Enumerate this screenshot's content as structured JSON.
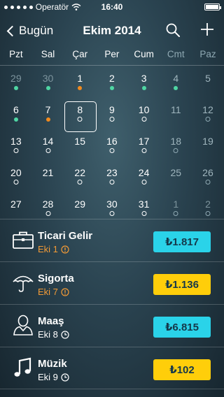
{
  "status_bar": {
    "carrier": "Operatör",
    "time": "16:40"
  },
  "nav": {
    "back_label": "Bugün",
    "title": "Ekim 2014"
  },
  "weekdays": [
    "Pzt",
    "Sal",
    "Çar",
    "Per",
    "Cum",
    "Cmt",
    "Paz"
  ],
  "calendar": {
    "weeks": [
      [
        {
          "d": "29",
          "dim": true,
          "m": "green"
        },
        {
          "d": "30",
          "dim": true,
          "m": "green"
        },
        {
          "d": "1",
          "m": "orange"
        },
        {
          "d": "2",
          "m": "green"
        },
        {
          "d": "3",
          "m": "green"
        },
        {
          "d": "4",
          "we": true,
          "m": "green"
        },
        {
          "d": "5",
          "we": true
        }
      ],
      [
        {
          "d": "6",
          "m": "green"
        },
        {
          "d": "7",
          "m": "orange"
        },
        {
          "d": "8",
          "today": true,
          "m": "ring"
        },
        {
          "d": "9",
          "m": "ring"
        },
        {
          "d": "10",
          "m": "ring"
        },
        {
          "d": "11",
          "we": true
        },
        {
          "d": "12",
          "we": true,
          "m": "ring"
        }
      ],
      [
        {
          "d": "13",
          "m": "ring"
        },
        {
          "d": "14",
          "m": "ring"
        },
        {
          "d": "15"
        },
        {
          "d": "16",
          "m": "ring"
        },
        {
          "d": "17",
          "m": "ring"
        },
        {
          "d": "18",
          "we": true,
          "m": "ring"
        },
        {
          "d": "19",
          "we": true
        }
      ],
      [
        {
          "d": "20",
          "m": "ring"
        },
        {
          "d": "21"
        },
        {
          "d": "22",
          "m": "ring"
        },
        {
          "d": "23",
          "m": "ring"
        },
        {
          "d": "24",
          "m": "ring"
        },
        {
          "d": "25",
          "we": true
        },
        {
          "d": "26",
          "we": true,
          "m": "ring"
        }
      ],
      [
        {
          "d": "27"
        },
        {
          "d": "28",
          "m": "ring"
        },
        {
          "d": "29"
        },
        {
          "d": "30",
          "m": "ring"
        },
        {
          "d": "31",
          "m": "ring"
        },
        {
          "d": "1",
          "dim": true,
          "m": "ring"
        },
        {
          "d": "2",
          "dim": true,
          "m": "ring"
        }
      ]
    ]
  },
  "items": [
    {
      "title": "Ticari Gelir",
      "date": "Eki 1",
      "status": "warning",
      "status_icon": "exclamation-icon",
      "icon": "briefcase-icon",
      "amount": "₺1.817",
      "amount_color": "#2ad3e9"
    },
    {
      "title": "Sigorta",
      "date": "Eki 7",
      "status": "warning",
      "status_icon": "exclamation-icon",
      "icon": "umbrella-icon",
      "amount": "₺1.136",
      "amount_color": "#ffce0a"
    },
    {
      "title": "Maaş",
      "date": "Eki 8",
      "status": "scheduled",
      "status_icon": "clock-icon",
      "icon": "person-icon",
      "amount": "₺6.815",
      "amount_color": "#2ad3e9"
    },
    {
      "title": "Müzik",
      "date": "Eki 9",
      "status": "scheduled",
      "status_icon": "clock-icon",
      "icon": "music-note-icon",
      "amount": "₺102",
      "amount_color": "#ffce0a"
    }
  ]
}
